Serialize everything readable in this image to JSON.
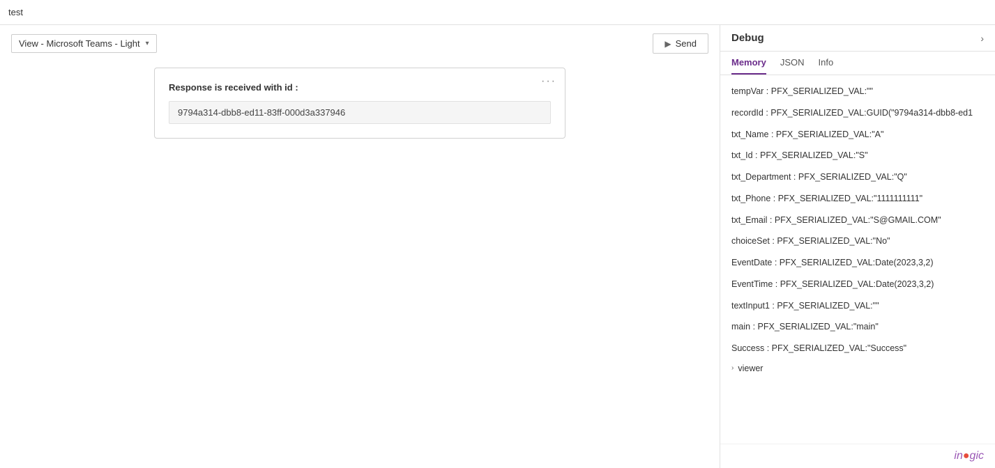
{
  "app": {
    "title": "test"
  },
  "toolbar": {
    "view_label": "View - Microsoft Teams - Light",
    "chevron": "▾",
    "send_label": "Send"
  },
  "card": {
    "menu_icon": "···",
    "label": "Response is received with id :",
    "value": "9794a314-dbb8-ed11-83ff-000d3a337946"
  },
  "debug": {
    "title": "Debug",
    "expand_icon": "›",
    "tabs": [
      {
        "label": "Memory",
        "active": true
      },
      {
        "label": "JSON",
        "active": false
      },
      {
        "label": "Info",
        "active": false
      }
    ],
    "memory_items": [
      {
        "text": "tempVar : PFX_SERIALIZED_VAL:\"\"",
        "collapsible": false
      },
      {
        "text": "recordId : PFX_SERIALIZED_VAL:GUID(\"9794a314-dbb8-ed1",
        "collapsible": false
      },
      {
        "text": "txt_Name : PFX_SERIALIZED_VAL:\"A\"",
        "collapsible": false
      },
      {
        "text": "txt_Id : PFX_SERIALIZED_VAL:\"S\"",
        "collapsible": false
      },
      {
        "text": "txt_Department : PFX_SERIALIZED_VAL:\"Q\"",
        "collapsible": false
      },
      {
        "text": "txt_Phone : PFX_SERIALIZED_VAL:\"1111111111\"",
        "collapsible": false
      },
      {
        "text": "txt_Email : PFX_SERIALIZED_VAL:\"S@GMAIL.COM\"",
        "collapsible": false
      },
      {
        "text": "choiceSet : PFX_SERIALIZED_VAL:\"No\"",
        "collapsible": false
      },
      {
        "text": "EventDate : PFX_SERIALIZED_VAL:Date(2023,3,2)",
        "collapsible": false
      },
      {
        "text": "EventTime : PFX_SERIALIZED_VAL:Date(2023,3,2)",
        "collapsible": false
      },
      {
        "text": "textInput1 : PFX_SERIALIZED_VAL:\"\"",
        "collapsible": false
      },
      {
        "text": "main : PFX_SERIALIZED_VAL:\"main\"",
        "collapsible": false
      },
      {
        "text": "Success : PFX_SERIALIZED_VAL:\"Success\"",
        "collapsible": false
      },
      {
        "text": "viewer",
        "collapsible": true
      }
    ],
    "branding": "in●oɡic"
  }
}
